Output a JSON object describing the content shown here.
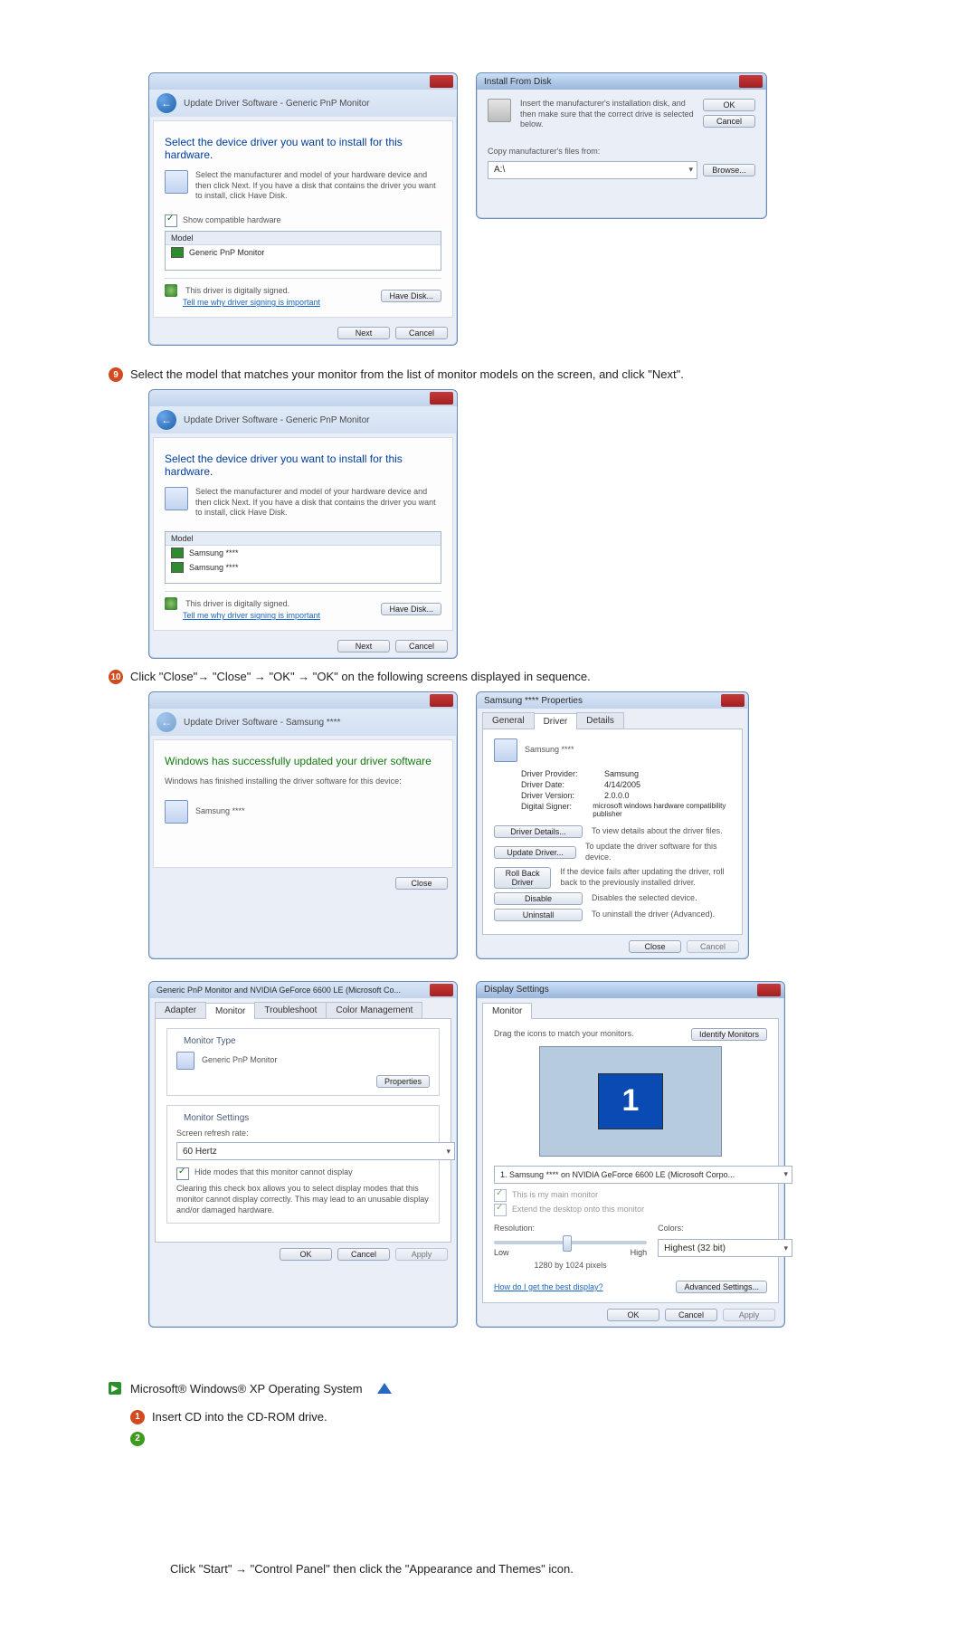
{
  "win_driver_select": {
    "breadcrumb": "Update Driver Software - Generic PnP Monitor",
    "heading": "Select the device driver you want to install for this hardware.",
    "hint": "Select the manufacturer and model of your hardware device and then click Next. If you have a disk that contains the driver you want to install, click Have Disk.",
    "show_compat": "Show compatible hardware",
    "col_model": "Model",
    "item1": "Generic PnP Monitor",
    "signed": "This driver is digitally signed.",
    "sign_link": "Tell me why driver signing is important",
    "have_disk": "Have Disk...",
    "next": "Next",
    "cancel": "Cancel"
  },
  "win_install_from_disk": {
    "title": "Install From Disk",
    "hint": "Insert the manufacturer's installation disk, and then make sure that the correct drive is selected below.",
    "ok": "OK",
    "cancel": "Cancel",
    "copy_label": "Copy manufacturer's files from:",
    "path": "A:\\",
    "browse": "Browse..."
  },
  "step9": "Select the model that matches your monitor from the list of monitor models on the screen, and click \"Next\".",
  "win_model_list": {
    "breadcrumb": "Update Driver Software - Generic PnP Monitor",
    "heading": "Select the device driver you want to install for this hardware.",
    "hint": "Select the manufacturer and model of your hardware device and then click Next. If you have a disk that contains the driver you want to install, click Have Disk.",
    "col_model": "Model",
    "item1": "Samsung ****",
    "item2": "Samsung ****",
    "signed": "This driver is digitally signed.",
    "sign_link": "Tell me why driver signing is important",
    "have_disk": "Have Disk...",
    "next": "Next",
    "cancel": "Cancel"
  },
  "step10": "Click \"Close\"→ \"Close\" → \"OK\" → \"OK\" on the following screens displayed in sequence.",
  "win_updated": {
    "breadcrumb": "Update Driver Software - Samsung ****",
    "heading": "Windows has successfully updated your driver software",
    "subtext": "Windows has finished installing the driver software for this device:",
    "device": "Samsung ****",
    "close": "Close"
  },
  "win_props": {
    "title": "Samsung **** Properties",
    "tab_general": "General",
    "tab_driver": "Driver",
    "tab_details": "Details",
    "device": "Samsung ****",
    "k_provider": "Driver Provider:",
    "v_provider": "Samsung",
    "k_date": "Driver Date:",
    "v_date": "4/14/2005",
    "k_version": "Driver Version:",
    "v_version": "2.0.0.0",
    "k_signer": "Digital Signer:",
    "v_signer": "microsoft windows hardware compatibility publisher",
    "btn_details": "Driver Details...",
    "desc_details": "To view details about the driver files.",
    "btn_update": "Update Driver...",
    "desc_update": "To update the driver software for this device.",
    "btn_rollback": "Roll Back Driver",
    "desc_rollback": "If the device fails after updating the driver, roll back to the previously installed driver.",
    "btn_disable": "Disable",
    "desc_disable": "Disables the selected device.",
    "btn_uninstall": "Uninstall",
    "desc_uninstall": "To uninstall the driver (Advanced).",
    "close": "Close",
    "cancel": "Cancel"
  },
  "win_adapter": {
    "title": "Generic PnP Monitor and NVIDIA GeForce 6600 LE (Microsoft Co...",
    "tab_adapter": "Adapter",
    "tab_monitor": "Monitor",
    "tab_trouble": "Troubleshoot",
    "tab_color": "Color Management",
    "grp_type": "Monitor Type",
    "type_val": "Generic PnP Monitor",
    "btn_props": "Properties",
    "grp_settings": "Monitor Settings",
    "lbl_refresh": "Screen refresh rate:",
    "refresh_val": "60 Hertz",
    "chk_hide": "Hide modes that this monitor cannot display",
    "hide_hint": "Clearing this check box allows you to select display modes that this monitor cannot display correctly. This may lead to an unusable display and/or damaged hardware.",
    "ok": "OK",
    "cancel": "Cancel",
    "apply": "Apply"
  },
  "win_display": {
    "title": "Display Settings",
    "tab_monitor": "Monitor",
    "drag": "Drag the icons to match your monitors.",
    "identify": "Identify Monitors",
    "monitor_num": "1",
    "device_select": "1. Samsung **** on NVIDIA GeForce 6600 LE (Microsoft Corpo...",
    "chk_main": "This is my main monitor",
    "chk_extend": "Extend the desktop onto this monitor",
    "lbl_res": "Resolution:",
    "lbl_low": "Low",
    "lbl_high": "High",
    "res_val": "1280 by 1024 pixels",
    "lbl_colors": "Colors:",
    "colors_val": "Highest (32 bit)",
    "help_link": "How do I get the best display?",
    "advanced": "Advanced Settings...",
    "ok": "OK",
    "cancel": "Cancel",
    "apply": "Apply"
  },
  "xp_header": "Microsoft® Windows® XP Operating System",
  "xp_step1": "Insert CD into the CD-ROM drive.",
  "xp_line2": "Click \"Start\" → \"Control Panel\" then click the \"Appearance and Themes\" icon.",
  "step_nums": {
    "s9": "9",
    "s10": "10",
    "s1": "1",
    "s2": "2"
  }
}
